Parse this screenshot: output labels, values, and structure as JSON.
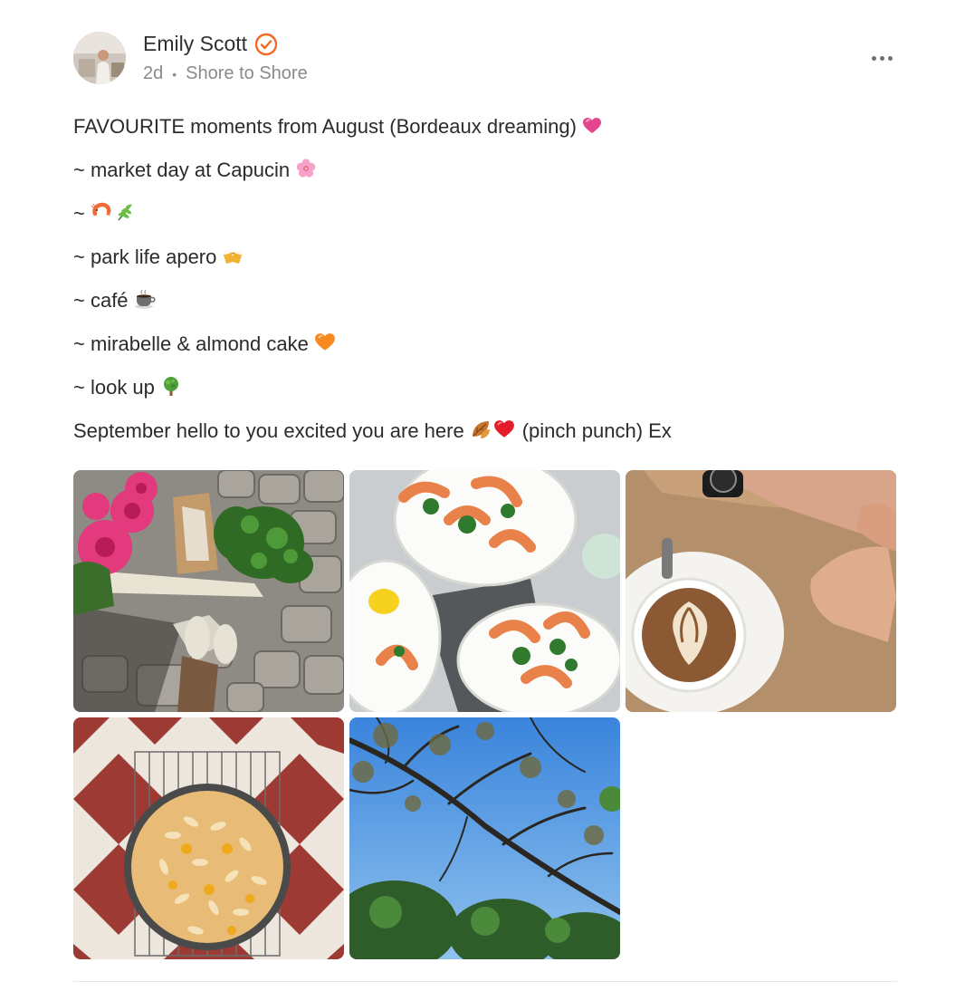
{
  "author": {
    "name": "Emily Scott",
    "verified_icon": "verified-badge-icon",
    "time": "2d",
    "publication": "Shore to Shore"
  },
  "menu_icon": "more-horizontal-icon",
  "post": {
    "lines": [
      {
        "text": "FAVOURITE moments from August (Bordeaux dreaming)",
        "emojis": [
          "pink-heart"
        ]
      },
      {
        "text": "~ market day at Capucin",
        "emojis": [
          "cherry-blossom"
        ]
      },
      {
        "text": "~",
        "emojis": [
          "shrimp",
          "herb"
        ]
      },
      {
        "text": "~ park life apero",
        "emojis": [
          "clinking-beer"
        ]
      },
      {
        "text": "~ café",
        "emojis": [
          "hot-coffee"
        ]
      },
      {
        "text": "~ mirabelle & almond cake",
        "emojis": [
          "orange-heart"
        ]
      },
      {
        "text": "~ look up",
        "emojis": [
          "deciduous-tree"
        ]
      },
      {
        "text": "September hello to you excited you are here",
        "emojis": [
          "fallen-leaf",
          "red-heart"
        ],
        "suffix": "(pinch punch) Ex"
      }
    ]
  },
  "photos": [
    {
      "subject": "flowers-and-herbs-photo"
    },
    {
      "subject": "prawns-plates-photo"
    },
    {
      "subject": "latte-cup-photo"
    },
    {
      "subject": "almond-cake-photo"
    },
    {
      "subject": "tree-branches-sky-photo"
    }
  ],
  "colors": {
    "accent": "#f26a21",
    "text": "#2b2b2b",
    "meta": "#8a8a8a",
    "divider": "#e5e5e5"
  }
}
